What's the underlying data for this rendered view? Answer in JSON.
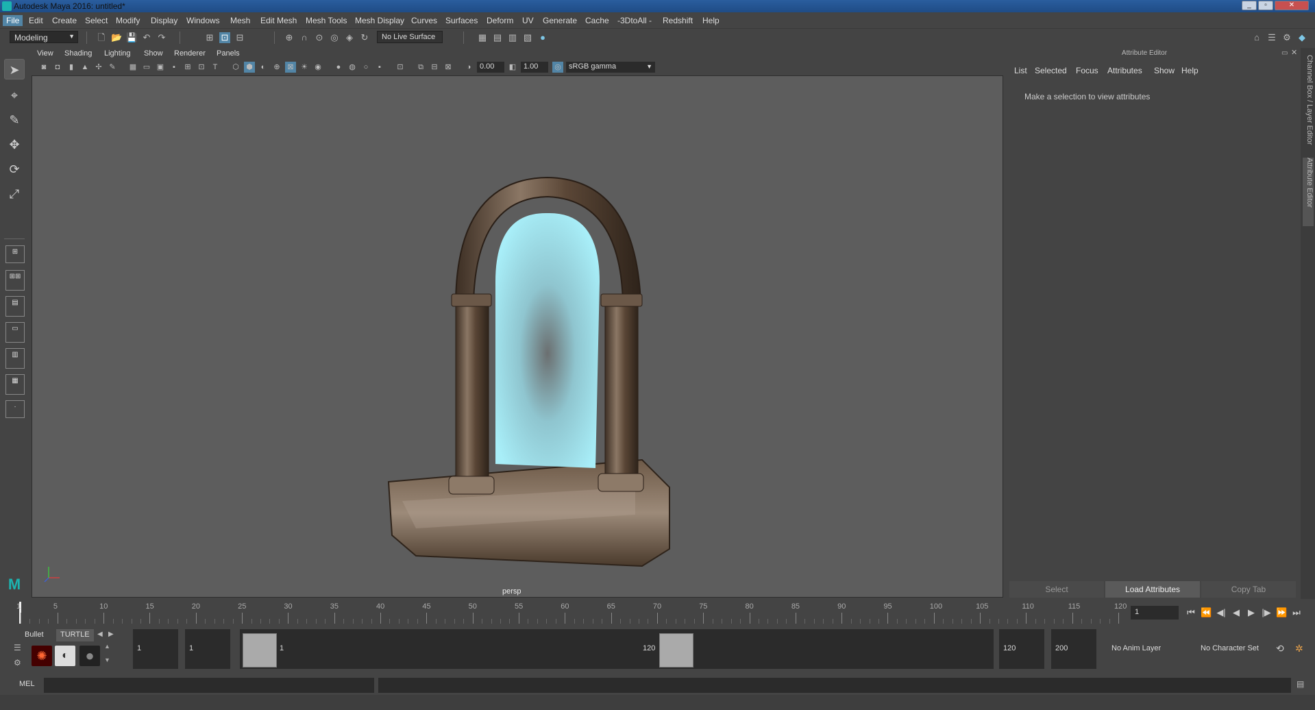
{
  "window": {
    "title": "Autodesk Maya 2016: untitled*"
  },
  "menubar": {
    "items": [
      "File",
      "Edit",
      "Create",
      "Select",
      "Modify",
      "Display",
      "Windows",
      "Mesh",
      "Edit Mesh",
      "Mesh Tools",
      "Mesh Display",
      "Curves",
      "Surfaces",
      "Deform",
      "UV",
      "Generate",
      "Cache",
      "-3DtoAll -",
      "Redshift",
      "Help"
    ]
  },
  "statusline": {
    "mode": "Modeling",
    "live_surface": "No Live Surface"
  },
  "viewport": {
    "menu": [
      "View",
      "Shading",
      "Lighting",
      "Show",
      "Renderer",
      "Panels"
    ],
    "exposure": "0.00",
    "gamma": "1.00",
    "color_space": "sRGB gamma",
    "camera_label": "persp"
  },
  "attribute_editor": {
    "title": "Attribute Editor",
    "menu": [
      "List",
      "Selected",
      "Focus",
      "Attributes",
      "Show",
      "Help"
    ],
    "message": "Make a selection to view attributes",
    "buttons": {
      "select": "Select",
      "load": "Load Attributes",
      "copy": "Copy Tab"
    },
    "side_tabs": {
      "channel_box": "Channel Box / Layer Editor",
      "attribute_editor": "Attribute Editor"
    }
  },
  "timeslider": {
    "tick_labels": [
      "1",
      "5",
      "10",
      "15",
      "20",
      "25",
      "30",
      "35",
      "40",
      "45",
      "50",
      "55",
      "60",
      "65",
      "70",
      "75",
      "80",
      "85",
      "90",
      "95",
      "100",
      "105",
      "110",
      "115",
      "120"
    ],
    "current_frame": "1"
  },
  "range_slider": {
    "start_time": "1",
    "playback_start": "1",
    "range_start_label": "1",
    "range_end_label": "120",
    "playback_end": "120",
    "end_time": "200",
    "anim_layer": "No Anim Layer",
    "character_set": "No Character Set"
  },
  "shelf": {
    "tabs": [
      "Bullet",
      "TURTLE"
    ]
  },
  "command_line": {
    "label": "MEL"
  },
  "colors": {
    "accent": "#5285a6",
    "portal_glow": "#9fe6f2",
    "viewport_bg": "#5d5d5d"
  }
}
